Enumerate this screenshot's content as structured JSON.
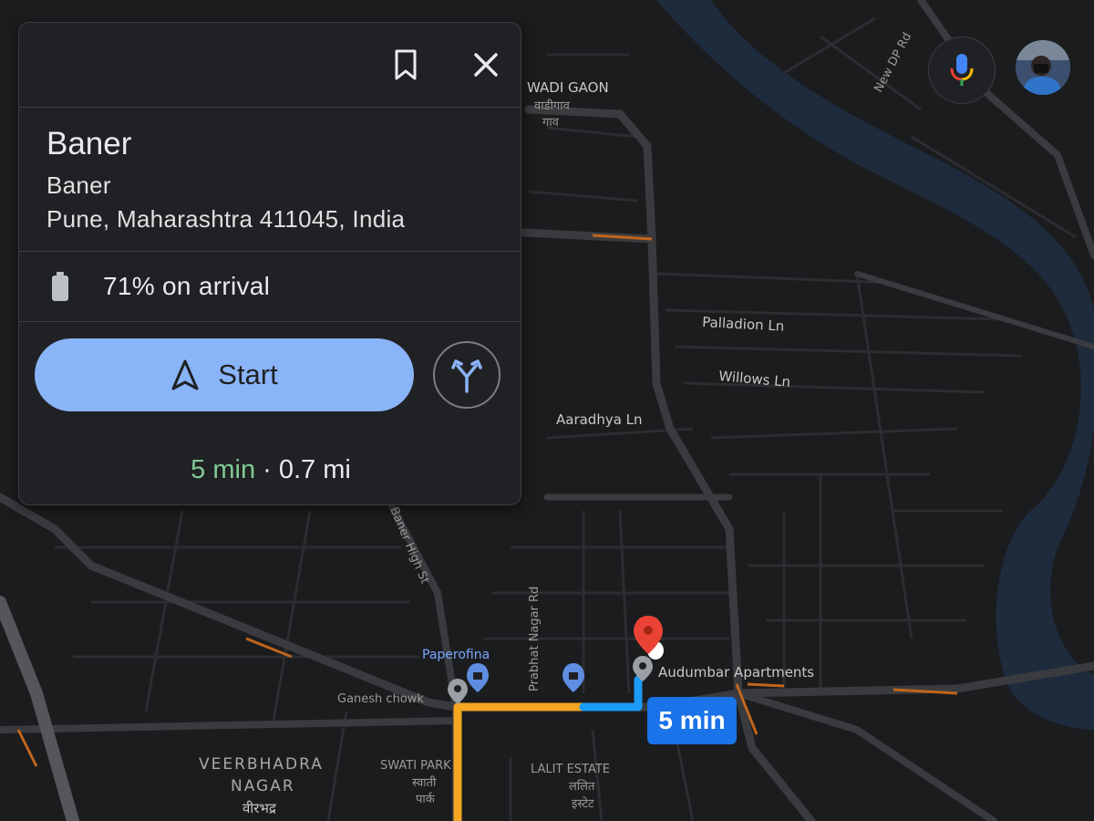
{
  "card": {
    "title": "Baner",
    "address_line1": "Baner",
    "address_line2": "Pune, Maharashtra 411045, India",
    "battery_text": "71% on arrival",
    "start_label": "Start",
    "eta": "5 min",
    "separator": " · ",
    "distance": "0.7 mi"
  },
  "map": {
    "route_badge": "5 min",
    "labels": {
      "wadi_gaon": "WADI GAON",
      "wadi_gaon_local1": "वाडीगाव",
      "wadi_gaon_local2": "गाव",
      "new_dp_rd": "New DP Rd",
      "palladion": "Palladion Ln",
      "willows": "Willows Ln",
      "aaradhya": "Aaradhya Ln",
      "high_st": "Baner High St",
      "prabhat": "Prabhat Nagar Rd",
      "paperofina": "Paperofina",
      "audumbar": "Audumbar Apartments",
      "ganesh": "Ganesh chowk",
      "veerbhadra1": "VEERBHADRA",
      "veerbhadra2": "NAGAR",
      "veerbhadra_local": "वीरभद्र",
      "swati": "SWATI PARK",
      "swati_local1": "स्वाती",
      "swati_local2": "पार्क",
      "lalit": "LALIT ESTATE",
      "lalit_local1": "ललित",
      "lalit_local2": "इस्टेट"
    }
  },
  "colors": {
    "background": "#1b1c1e",
    "road": "#3a3b3e",
    "river": "#1e2b3d",
    "route_blue": "#1a9bf5",
    "route_orange": "#f5a623",
    "destination_pin": "#ea4335",
    "accent": "#8ab4f8",
    "eta_green": "#81c995"
  },
  "icons": {
    "bookmark": "bookmark-icon",
    "close": "close-icon",
    "battery": "battery-icon",
    "navigate": "navigation-arrow-icon",
    "route_options": "route-options-icon",
    "mic": "mic-icon",
    "pin": "destination-pin-icon"
  }
}
